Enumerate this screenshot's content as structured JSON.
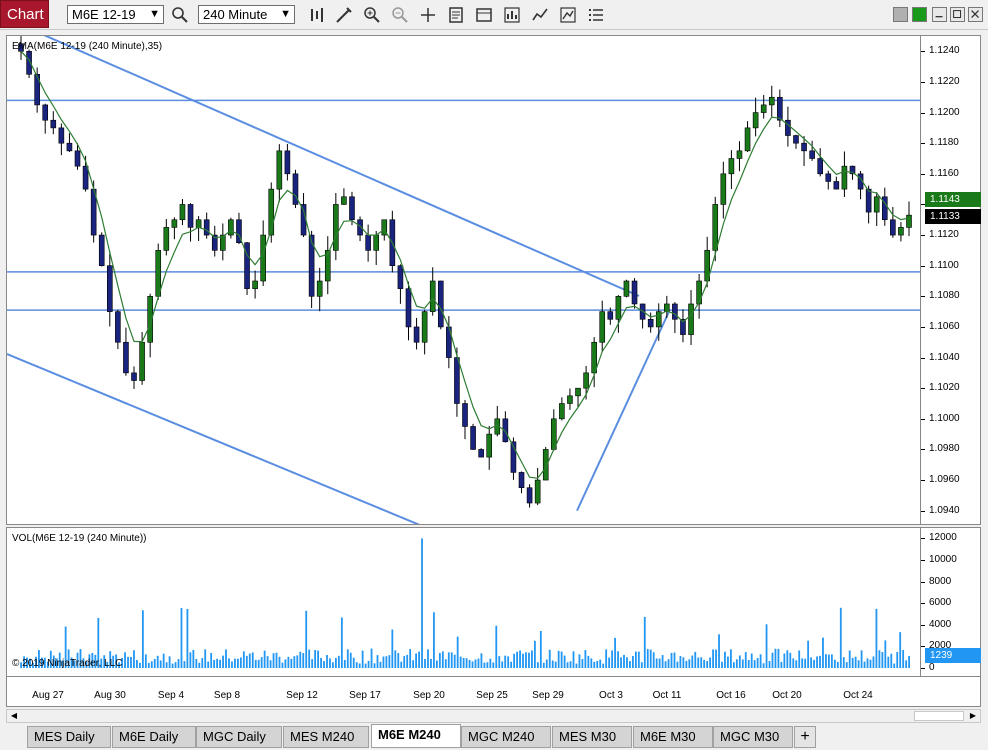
{
  "toolbar": {
    "title": "Chart",
    "instrument": "M6E 12-19",
    "interval": "240 Minute"
  },
  "price_panel": {
    "indicator_label": "EMA(M6E 12-19 (240 Minute),35)",
    "copyright": "© 2019 NinjaTrader, LLC",
    "axis_labels": [
      "1.1240",
      "1.1220",
      "1.1200",
      "1.1180",
      "1.1160",
      "1.1140",
      "1.1120",
      "1.1100",
      "1.1080",
      "1.1060",
      "1.1040",
      "1.1020",
      "1.1000",
      "1.0980",
      "1.0960",
      "1.0940"
    ],
    "price_tags": [
      {
        "label": "1.1143",
        "color": "#1a7a1a"
      },
      {
        "label": "1.1133",
        "color": "#000000"
      }
    ]
  },
  "volume_panel": {
    "indicator_label": "VOL(M6E 12-19 (240 Minute))",
    "axis_labels": [
      "12000",
      "10000",
      "8000",
      "6000",
      "4000",
      "2000",
      "0"
    ],
    "last_volume_tag": "1239"
  },
  "date_axis": {
    "labels": [
      "Aug 27",
      "Aug 30",
      "Sep 4",
      "Sep 8",
      "Sep 12",
      "Sep 17",
      "Sep 20",
      "Sep 25",
      "Sep 29",
      "Oct 3",
      "Oct 11",
      "Oct 16",
      "Oct 20",
      "Oct 24"
    ]
  },
  "tabs": [
    {
      "label": "MES  Daily"
    },
    {
      "label": "M6E  Daily"
    },
    {
      "label": "MGC  Daily"
    },
    {
      "label": "MES  M240"
    },
    {
      "label": "M6E  M240"
    },
    {
      "label": "MGC  M240"
    },
    {
      "label": "MES  M30"
    },
    {
      "label": "M6E  M30"
    },
    {
      "label": "MGC M30"
    }
  ],
  "active_tab": 4,
  "colors": {
    "title_bg": "#a8172b",
    "up_candle": "#1a7a1a",
    "down_candle": "#1a237e",
    "ema_line": "#2e7d32",
    "drawing_lines": "#5b8de0",
    "volume_bars": "#2196f3"
  },
  "chart_data": {
    "type": "candlestick",
    "title": "",
    "y_range": [
      1.093,
      1.125
    ],
    "ema_period": 35,
    "horizontal_lines": [
      1.1208,
      1.1096,
      1.1071
    ],
    "close_series": [
      1.124,
      1.1225,
      1.1205,
      1.1195,
      1.119,
      1.118,
      1.1175,
      1.1165,
      1.115,
      1.112,
      1.11,
      1.107,
      1.105,
      1.103,
      1.1025,
      1.105,
      1.108,
      1.111,
      1.1125,
      1.113,
      1.114,
      1.1125,
      1.113,
      1.112,
      1.111,
      1.112,
      1.113,
      1.1115,
      1.1085,
      1.109,
      1.112,
      1.115,
      1.1175,
      1.116,
      1.114,
      1.112,
      1.108,
      1.109,
      1.111,
      1.114,
      1.1145,
      1.113,
      1.112,
      1.111,
      1.112,
      1.113,
      1.11,
      1.1085,
      1.106,
      1.105,
      1.107,
      1.109,
      1.106,
      1.104,
      1.101,
      1.0995,
      1.098,
      1.0975,
      1.099,
      1.1,
      1.0985,
      1.0965,
      1.0955,
      1.0945,
      1.096,
      1.098,
      1.1,
      1.101,
      1.1015,
      1.102,
      1.103,
      1.105,
      1.107,
      1.1065,
      1.108,
      1.109,
      1.1075,
      1.1065,
      1.106,
      1.107,
      1.1075,
      1.1065,
      1.1055,
      1.1075,
      1.109,
      1.111,
      1.114,
      1.116,
      1.117,
      1.1175,
      1.119,
      1.12,
      1.1205,
      1.121,
      1.1195,
      1.1185,
      1.118,
      1.1175,
      1.117,
      1.116,
      1.1155,
      1.115,
      1.1165,
      1.116,
      1.115,
      1.1135,
      1.1145,
      1.113,
      1.112,
      1.1125,
      1.1133
    ],
    "volume_max": 12000,
    "last_price": 1.1133
  }
}
